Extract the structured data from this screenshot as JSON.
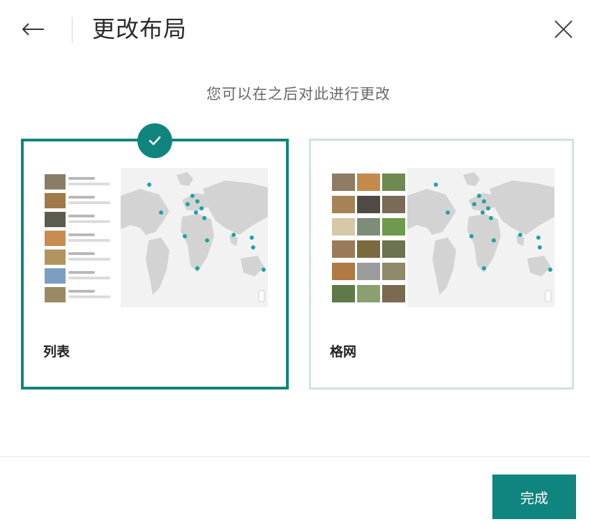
{
  "header": {
    "title": "更改布局",
    "back_icon": "arrow-left-icon",
    "close_icon": "close-icon"
  },
  "subtitle": "您可以在之后对此进行更改",
  "layouts": [
    {
      "label": "列表",
      "selected": true,
      "icon": "checkmark-icon"
    },
    {
      "label": "格网",
      "selected": false
    }
  ],
  "footer": {
    "done_label": "完成"
  },
  "colors": {
    "accent": "#10847e",
    "unselected_border": "#cfe2e4",
    "map_ocean": "#f2f2f2",
    "map_land": "#d3d3d3",
    "map_pin": "#1aa3a6"
  }
}
